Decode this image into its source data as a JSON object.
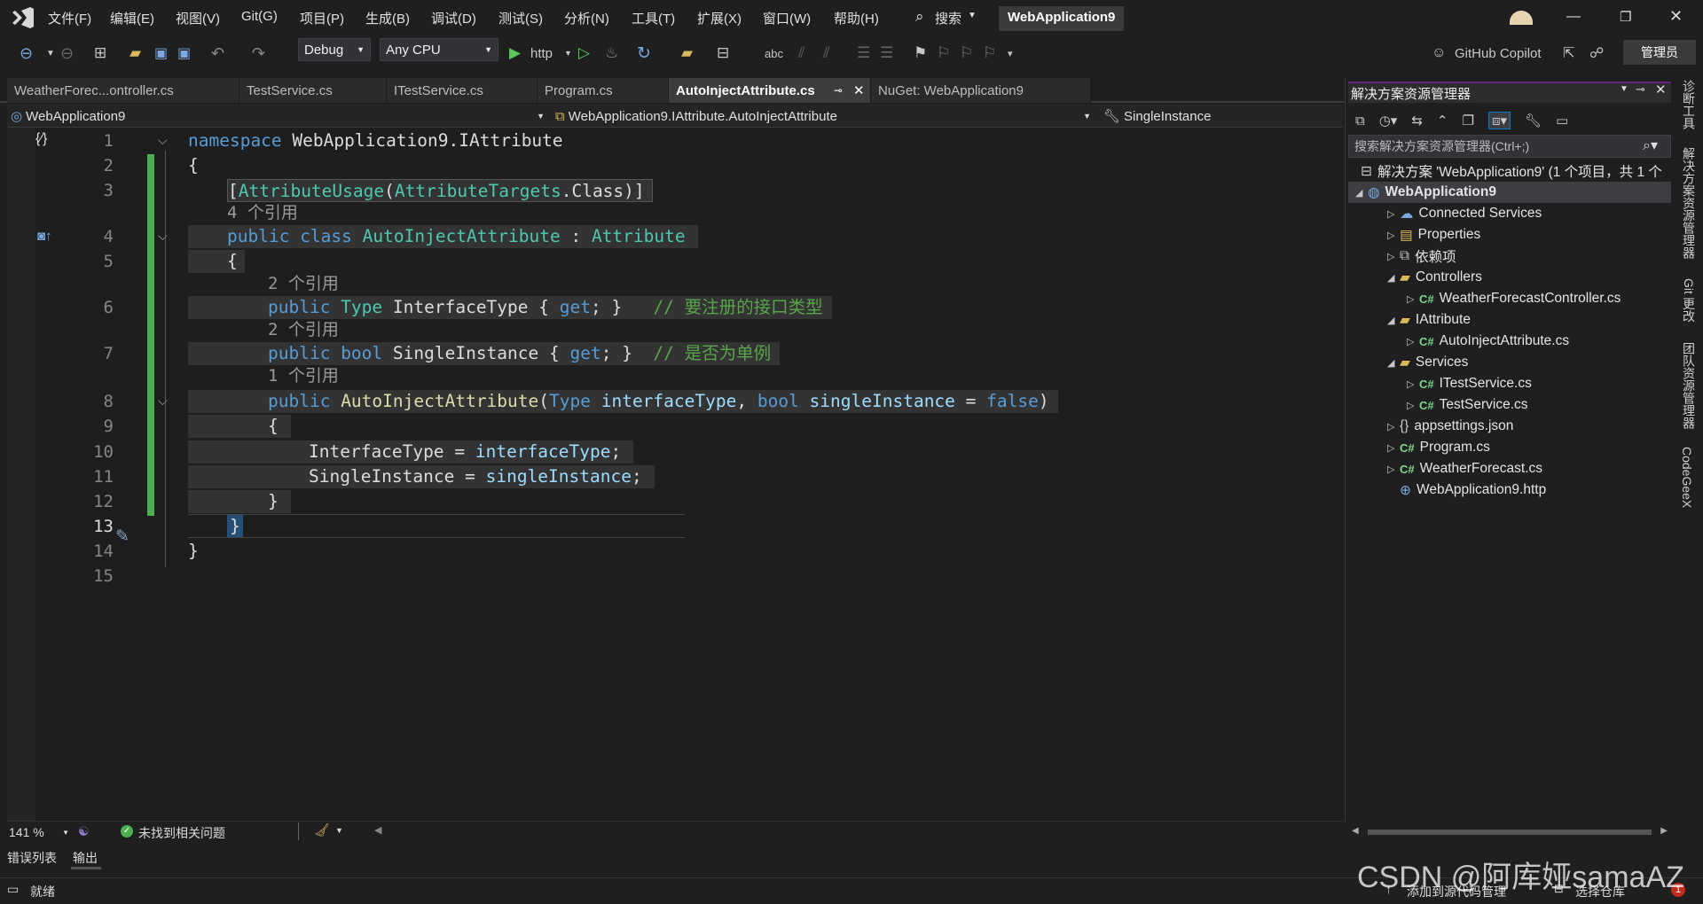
{
  "menu": [
    "文件(F)",
    "编辑(E)",
    "视图(V)",
    "Git(G)",
    "项目(P)",
    "生成(B)",
    "调试(D)",
    "测试(S)",
    "分析(N)",
    "工具(T)",
    "扩展(X)",
    "窗口(W)",
    "帮助(H)"
  ],
  "search_label": "搜索",
  "window_title": "WebApplication9",
  "toolbar": {
    "config": "Debug",
    "platform": "Any CPU",
    "run_label": "http",
    "copilot": "GitHub Copilot",
    "admin": "管理员"
  },
  "tabs": [
    "WeatherForec...ontroller.cs",
    "TestService.cs",
    "ITestService.cs",
    "Program.cs",
    "AutoInjectAttribute.cs",
    "NuGet: WebApplication9"
  ],
  "nav": {
    "project": "WebApplication9",
    "type": "WebApplication9.IAttribute.AutoInjectAttribute",
    "member": "SingleInstance"
  },
  "line_numbers": [
    "1",
    "2",
    "3",
    "4",
    "5",
    "6",
    "7",
    "8",
    "9",
    "10",
    "11",
    "12",
    "13",
    "14",
    "15"
  ],
  "code": {
    "l1a": "namespace",
    "l1b": " WebApplication9.IAttribute",
    "l2": "{",
    "l3a": "[",
    "l3b": "AttributeUsage",
    "l3c": "(",
    "l3d": "AttributeTargets",
    "l3e": ".Class)]",
    "ref4": "4 个引用",
    "l4a": "public",
    "l4b": " class",
    "l4c": " AutoInjectAttribute",
    "l4d": " : ",
    "l4e": "Attribute",
    "l5": "{",
    "ref6": "2 个引用",
    "l6a": "public",
    "l6b": " Type",
    "l6c": " InterfaceType { ",
    "l6d": "get",
    "l6e": "; }",
    "l6f": "   // 要注册的接口类型",
    "ref7": "2 个引用",
    "l7a": "public",
    "l7b": " bool",
    "l7c": " SingleInstance { ",
    "l7d": "get",
    "l7e": "; }",
    "l7f": "  // 是否为单例",
    "ref8": "1 个引用",
    "l8a": "public",
    "l8b": " AutoInjectAttribute",
    "l8c": "(",
    "l8d": "Type",
    "l8e": " interfaceType",
    "l8f": ", ",
    "l8g": "bool",
    "l8h": " singleInstance",
    "l8i": " = ",
    "l8j": "false",
    "l8k": ")",
    "l9": "{",
    "l10a": "InterfaceType",
    "l10b": " = ",
    "l10c": "interfaceType",
    "l10d": ";",
    "l11a": "SingleInstance",
    "l11b": " = ",
    "l11c": "singleInstance",
    "l11d": ";",
    "l12": "}",
    "l13": "}",
    "l14": "}"
  },
  "editor_status": {
    "zoom": "141 %",
    "issues": "未找到相关问题"
  },
  "bottom_tabs": [
    "错误列表",
    "输出"
  ],
  "status": {
    "ready": "就绪",
    "add_source": "添加到源代码管理",
    "select_repo": "选择仓库"
  },
  "solution_explorer": {
    "title": "解决方案资源管理器",
    "search_placeholder": "搜索解决方案资源管理器(Ctrl+;)",
    "solution": "解决方案 'WebApplication9' (1 个项目，共 1 个",
    "project": "WebApplication9",
    "items": [
      {
        "label": "Connected Services",
        "indent": 1,
        "arrow": "▷",
        "icon": "connected-services-icon"
      },
      {
        "label": "Properties",
        "indent": 1,
        "arrow": "▷",
        "icon": "properties-icon"
      },
      {
        "label": "依赖项",
        "indent": 1,
        "arrow": "▷",
        "icon": "dependencies-icon"
      },
      {
        "label": "Controllers",
        "indent": 1,
        "arrow": "◢",
        "icon": "folder-icon"
      },
      {
        "label": "WeatherForecastController.cs",
        "indent": 2,
        "arrow": "▷",
        "icon": "csharp-file-icon"
      },
      {
        "label": "IAttribute",
        "indent": 1,
        "arrow": "◢",
        "icon": "folder-icon"
      },
      {
        "label": "AutoInjectAttribute.cs",
        "indent": 2,
        "arrow": "▷",
        "icon": "csharp-file-icon"
      },
      {
        "label": "Services",
        "indent": 1,
        "arrow": "◢",
        "icon": "folder-icon"
      },
      {
        "label": "ITestService.cs",
        "indent": 2,
        "arrow": "▷",
        "icon": "csharp-file-icon"
      },
      {
        "label": "TestService.cs",
        "indent": 2,
        "arrow": "▷",
        "icon": "csharp-file-icon"
      },
      {
        "label": "appsettings.json",
        "indent": 1,
        "arrow": "▷",
        "icon": "json-file-icon"
      },
      {
        "label": "Program.cs",
        "indent": 1,
        "arrow": "▷",
        "icon": "csharp-file-icon"
      },
      {
        "label": "WeatherForecast.cs",
        "indent": 1,
        "arrow": "▷",
        "icon": "csharp-file-icon"
      },
      {
        "label": "WebApplication9.http",
        "indent": 1,
        "arrow": "",
        "icon": "http-file-icon"
      }
    ]
  },
  "right_rail": [
    "诊断工具",
    "解决方案资源管理器",
    "Git 更改",
    "团队资源管理器",
    "CodeGeeX"
  ],
  "watermark": "CSDN @阿库娅samaAZ",
  "colors": {
    "accent": "#68217a",
    "keyword": "#569cd6",
    "type": "#4ec9b0",
    "comment": "#57a64a",
    "change_bar": "#4caf50"
  }
}
